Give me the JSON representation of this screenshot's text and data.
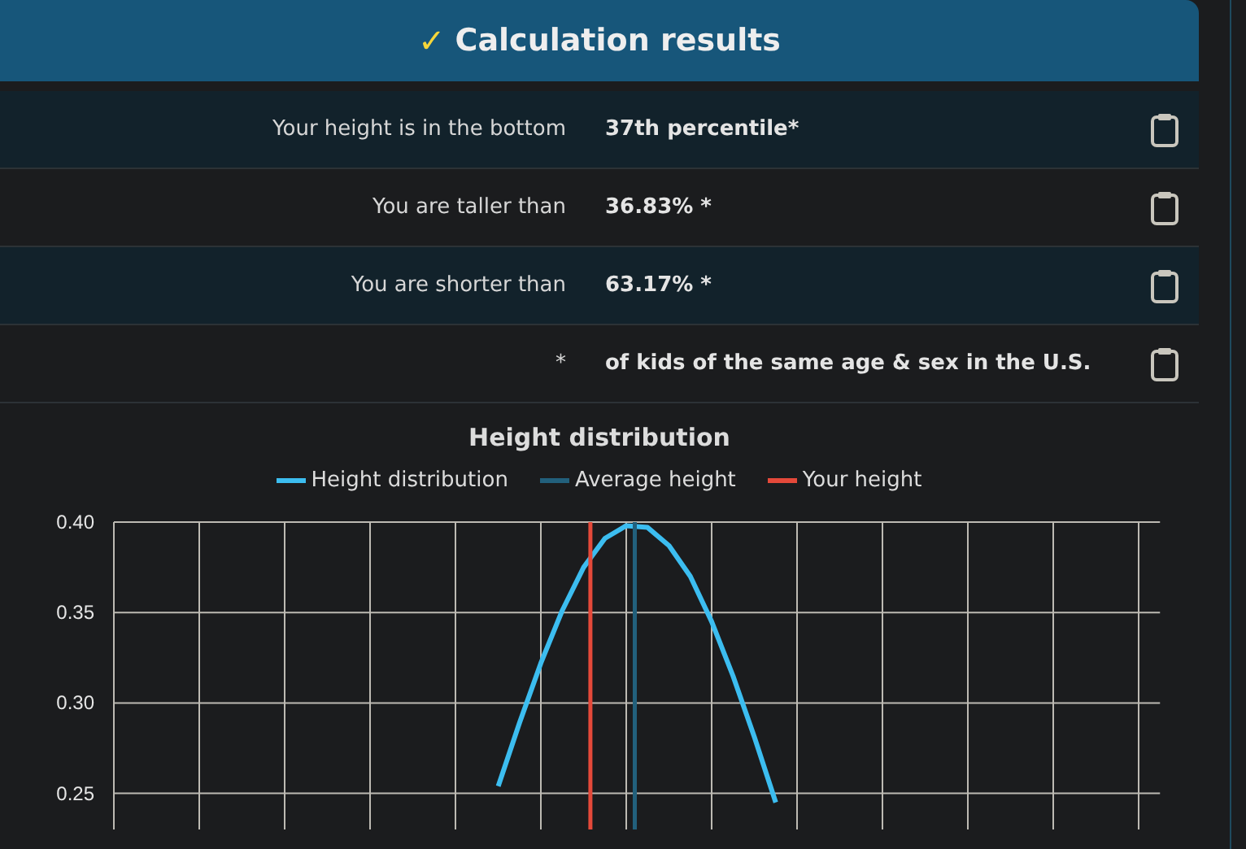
{
  "header": {
    "title": "Calculation results",
    "icon": "✓"
  },
  "results": [
    {
      "label": "Your height is in the bottom",
      "value": "37th percentile*",
      "shaded": true
    },
    {
      "label": "You are taller than",
      "value": "36.83% *",
      "shaded": false
    },
    {
      "label": "You are shorter than",
      "value": "63.17% *",
      "shaded": true
    },
    {
      "label": "*",
      "value": "of kids of the same age & sex in the U.S.",
      "shaded": false
    }
  ],
  "chart": {
    "legend": [
      {
        "label": "Average height",
        "color": "#22607c"
      },
      {
        "label": "Your height",
        "color": "#e5493a"
      }
    ],
    "chart_data": {
      "type": "line",
      "title": "Height distribution",
      "grid": true,
      "ylim": [
        0.23,
        0.4
      ],
      "yticks": [
        {
          "value": 0.4,
          "label": "0.40"
        },
        {
          "value": 0.35,
          "label": "0.35"
        },
        {
          "value": 0.3,
          "label": "0.30"
        },
        {
          "value": 0.25,
          "label": "0.25"
        }
      ],
      "categories": [
        null,
        null,
        null,
        null,
        null,
        null,
        null,
        null,
        null,
        null,
        null,
        null,
        null,
        null,
        null,
        null,
        null,
        null,
        null,
        null,
        null,
        null,
        null,
        null,
        null,
        null,
        null,
        null,
        null,
        null,
        null,
        null,
        null,
        null,
        null,
        null,
        null,
        null,
        null,
        null,
        null,
        null,
        null,
        null,
        null,
        null,
        null,
        null,
        null,
        null
      ],
      "series": [
        {
          "name": "Height distribution",
          "color": "#3cbdf0",
          "values": [
            null,
            null,
            null,
            null,
            null,
            null,
            null,
            null,
            null,
            null,
            null,
            null,
            null,
            null,
            null,
            null,
            null,
            null,
            0.254,
            0.289,
            0.322,
            0.351,
            0.375,
            0.391,
            0.398,
            0.397,
            0.387,
            0.37,
            0.345,
            0.315,
            0.281,
            0.245,
            null,
            null,
            null,
            null,
            null,
            null,
            null,
            null,
            null,
            null,
            null,
            null,
            null,
            null,
            null,
            null,
            null,
            null
          ]
        }
      ]
    }
  }
}
